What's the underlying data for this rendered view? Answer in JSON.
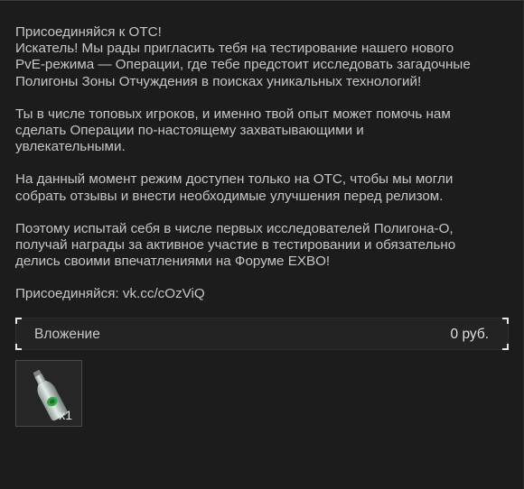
{
  "message": {
    "paragraphs": [
      [
        "Присоединяйся к ОТС!",
        "Искатель! Мы рады пригласить тебя на тестирование нашего нового",
        "PvE-режима — Операции, где тебе предстоит исследовать загадочные",
        "Полигоны Зоны Отчуждения в поисках уникальных технологий!"
      ],
      [
        "Ты в числе топовых игроков, и именно твой опыт может помочь нам",
        "сделать Операции по-настоящему захватывающими и",
        "увлекательными."
      ],
      [
        "На данный момент режим доступен только на ОТС, чтобы мы могли",
        "собрать отзывы и внести необходимые улучшения перед релизом."
      ],
      [
        "Поэтому испытай себя в числе первых исследователей Полигона-О,",
        "получай награды за активное участие в тестировании и обязательно",
        "делись своими впечатлениями на Форуме EXBO!"
      ],
      [
        "Присоединяйся: vk.cc/cOzViQ"
      ]
    ]
  },
  "attachment": {
    "label": "Вложение",
    "amount": "0 руб."
  },
  "item": {
    "icon": "bottle-icon",
    "quantity": "x1"
  }
}
